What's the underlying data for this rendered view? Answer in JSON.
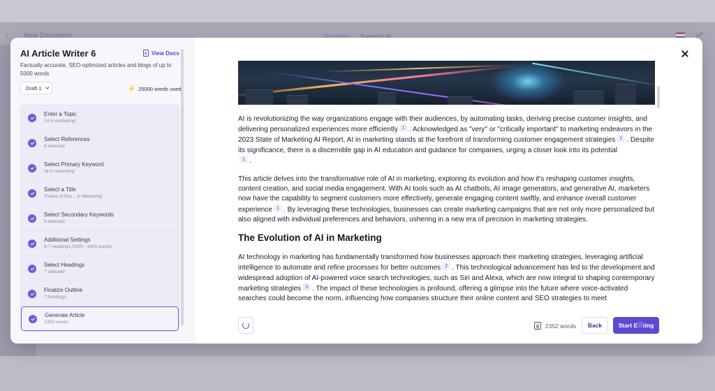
{
  "background": {
    "document_title": "New Document",
    "tab_premium": "Premium",
    "tab_superior": "Superior AI"
  },
  "left": {
    "title": "AI Article Writer 6",
    "view_docs": "View Docs",
    "description": "Factually accurate, SEO-optimized articles and blogs of up to 5000 words",
    "draft": "Draft 1",
    "words_used": "25000 words used",
    "steps": [
      {
        "title": "Enter a Topic",
        "sub": "'AI in marketing'"
      },
      {
        "title": "Select References",
        "sub": "4 selected"
      },
      {
        "title": "Select Primary Keyword",
        "sub": "'ai in marketing'"
      },
      {
        "title": "Select a Title",
        "sub": "'Future of Bus... in Marketing'"
      },
      {
        "title": "Select Secondary Keywords",
        "sub": "5 selected"
      },
      {
        "title": "Additional Settings",
        "sub": "6-7 headings (2000 - 3000 words)"
      },
      {
        "title": "Select Headings",
        "sub": "7 selected"
      },
      {
        "title": "Finalize Outline",
        "sub": "7 headings"
      },
      {
        "title": "Generate Article",
        "sub": "2352 words"
      }
    ]
  },
  "article": {
    "p1a": "AI is revolutionizing the way organizations engage with their audiences, by automating tasks, deriving precise customer insights, and delivering personalized experiences more efficiently",
    "p1b": ". Acknowledged as \"very\" or \"critically important\" to marketing endeavors in the 2023 State of Marketing AI Report, AI in marketing stands at the forefront of transforming customer engagement strategies",
    "p1c": ". Despite its significance, there is a discernible gap in AI education and guidance for companies, urging a closer look into its potential",
    "p1d": ".",
    "p2a": "This article delves into the transformative role of AI in marketing, exploring its evolution and how it's reshaping customer insights, content creation, and social media engagement. With AI tools such as AI chatbots, AI image generators, and generative AI, marketers now have the capability to segment customers more effectively, generate engaging content swiftly, and enhance overall customer experience",
    "p2b": ". By leveraging these technologies, businesses can create marketing campaigns that are not only more personalized but also aligned with individual preferences and behaviors, ushering in a new era of precision in marketing strategies.",
    "heading": "The Evolution of AI in Marketing",
    "p3a": "AI technology in marketing has fundamentally transformed how businesses approach their marketing strategies, leveraging artificial intelligence to automate and refine processes for better outcomes",
    "p3b": ". This technological advancement has led to the development and widespread adoption of AI-powered voice search technologies, such as Siri and Alexa, which are now integral to shaping contemporary marketing strategies",
    "p3c": ". The impact of these technologies is profound, offering a glimpse into the future where voice-activated searches could become the norm, influencing how companies structure their online content and SEO strategies to meet",
    "cite1": "1",
    "cite2": "2",
    "cite3": "3"
  },
  "footer": {
    "word_count": "2352 words",
    "back": "Back",
    "start": "Start Editing"
  },
  "colors": {
    "accent": "#5b4bd0",
    "check": "#6a5dd6"
  }
}
